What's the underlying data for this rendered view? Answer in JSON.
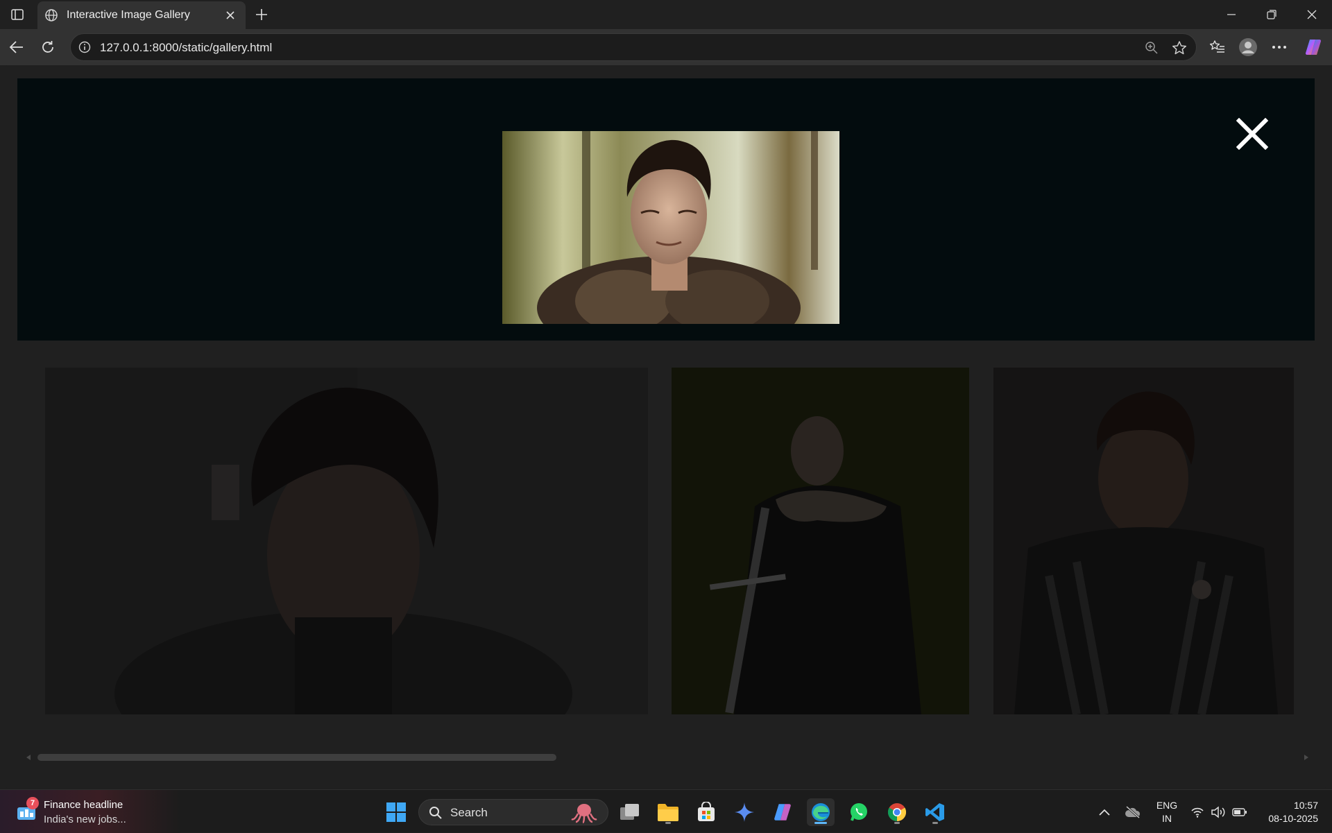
{
  "browser": {
    "tab_title": "Interactive Image Gallery",
    "url": "127.0.0.1:8000/static/gallery.html"
  },
  "gallery": {
    "lightbox_close_label": "✕"
  },
  "taskbar": {
    "news_badge": "7",
    "news_title": "Finance headline",
    "news_subtitle": "India's new jobs...",
    "search_label": "Search",
    "lang_line1": "ENG",
    "lang_line2": "IN",
    "time": "10:57",
    "date": "08-10-2025"
  },
  "colors": {
    "lightbox_bg": "#030c0e",
    "accent": "#5eb6f7"
  }
}
